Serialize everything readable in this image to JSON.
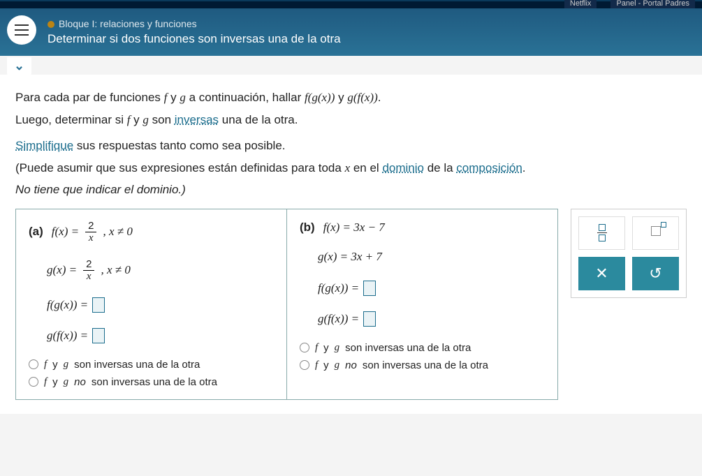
{
  "nav": {
    "netflix": "Netflix",
    "panel": "Panel - Portal Padres"
  },
  "header": {
    "bloque": "Bloque I: relaciones y funciones",
    "title": "Determinar si dos funciones son inversas una de la otra"
  },
  "intro": {
    "l1a": "Para cada par de funciones ",
    "l1b": " y ",
    "l1c": " a continuación, hallar ",
    "l1d": " y ",
    "l1e": ".",
    "l2a": "Luego, determinar si ",
    "l2b": " y ",
    "l2c": " son ",
    "inversas": "inversas",
    "l2d": " una de la otra.",
    "simplifique": "Simplifique",
    "l3": " sus respuestas tanto como sea posible.",
    "l4a": "(Puede asumir que sus expresiones están definidas para toda ",
    "l4b": " en el ",
    "dominio": "dominio",
    "l4c": " de la ",
    "composicion": "composición",
    "l4d": ".",
    "l5": "No tiene que indicar el dominio.)"
  },
  "col_a": {
    "label": "(a)",
    "f_lhs": "f(x) = ",
    "frac_n": "2",
    "frac_d": "x",
    "cond": " ,  x ≠ 0",
    "g_lhs": "g(x) = ",
    "fg": "f(g(x))  =  ",
    "gf": "g(f(x))  =  ",
    "r1": "f y g son inversas una de la otra",
    "r2": "f y g no son inversas una de la otra"
  },
  "col_b": {
    "label": "(b)",
    "f": "f(x) = 3x − 7",
    "g": "g(x) = 3x + 7",
    "fg": "f(g(x))  =  ",
    "gf": "g(f(x))  =  ",
    "r1": "f y g son inversas una de la otra",
    "r2": "f y g no son inversas una de la otra"
  },
  "tools": {
    "x": "✕",
    "undo": "↺"
  }
}
